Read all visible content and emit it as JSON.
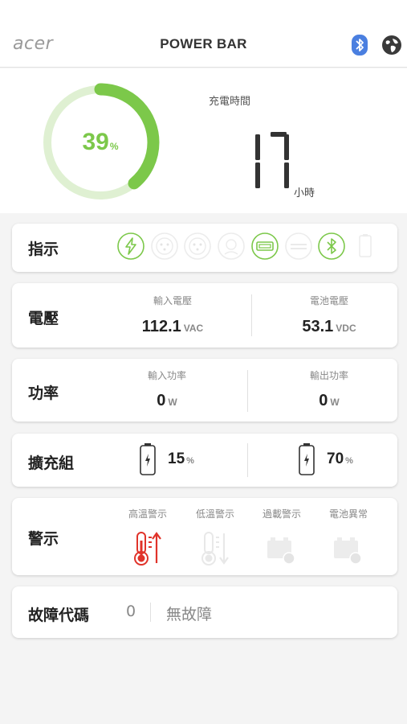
{
  "header": {
    "logo_text": "acer",
    "title": "POWER BAR",
    "bluetooth_icon": "bluetooth-icon",
    "language_icon": "globe-icon"
  },
  "battery": {
    "percent": 39,
    "percent_text": "39",
    "percent_unit": "%",
    "charge_time_label": "充電時間",
    "charge_time_value": "17",
    "charge_time_unit": "小時",
    "accent_color": "#7cc84a"
  },
  "indicator": {
    "title": "指示",
    "icons": [
      {
        "name": "charging-bolt-icon",
        "active": true
      },
      {
        "name": "ac-outlet-1-icon",
        "active": false
      },
      {
        "name": "ac-outlet-2-icon",
        "active": false
      },
      {
        "name": "car-socket-icon",
        "active": false
      },
      {
        "name": "usb-port-icon",
        "active": true
      },
      {
        "name": "dc-output-icon",
        "active": false
      },
      {
        "name": "bluetooth-icon",
        "active": true
      },
      {
        "name": "battery-pack-icon",
        "active": false
      }
    ]
  },
  "voltage": {
    "title": "電壓",
    "input_label": "輸入電壓",
    "input_value": "112.1",
    "input_unit": "VAC",
    "battery_label": "電池電壓",
    "battery_value": "53.1",
    "battery_unit": "VDC"
  },
  "power": {
    "title": "功率",
    "input_label": "輸入功率",
    "input_value": "0",
    "input_unit": "W",
    "output_label": "輸出功率",
    "output_value": "0",
    "output_unit": "W"
  },
  "expansion": {
    "title": "擴充組",
    "pack1_value": "15",
    "pack1_unit": "%",
    "pack2_value": "70",
    "pack2_unit": "%"
  },
  "alerts": {
    "title": "警示",
    "items": [
      {
        "label": "高溫警示",
        "icon": "high-temp-icon",
        "active": true
      },
      {
        "label": "低溫警示",
        "icon": "low-temp-icon",
        "active": false
      },
      {
        "label": "過載警示",
        "icon": "overload-icon",
        "active": false
      },
      {
        "label": "電池異常",
        "icon": "battery-fault-icon",
        "active": false
      }
    ],
    "active_color": "#e0332a"
  },
  "fault": {
    "title": "故障代碼",
    "code": "0",
    "description": "無故障"
  }
}
